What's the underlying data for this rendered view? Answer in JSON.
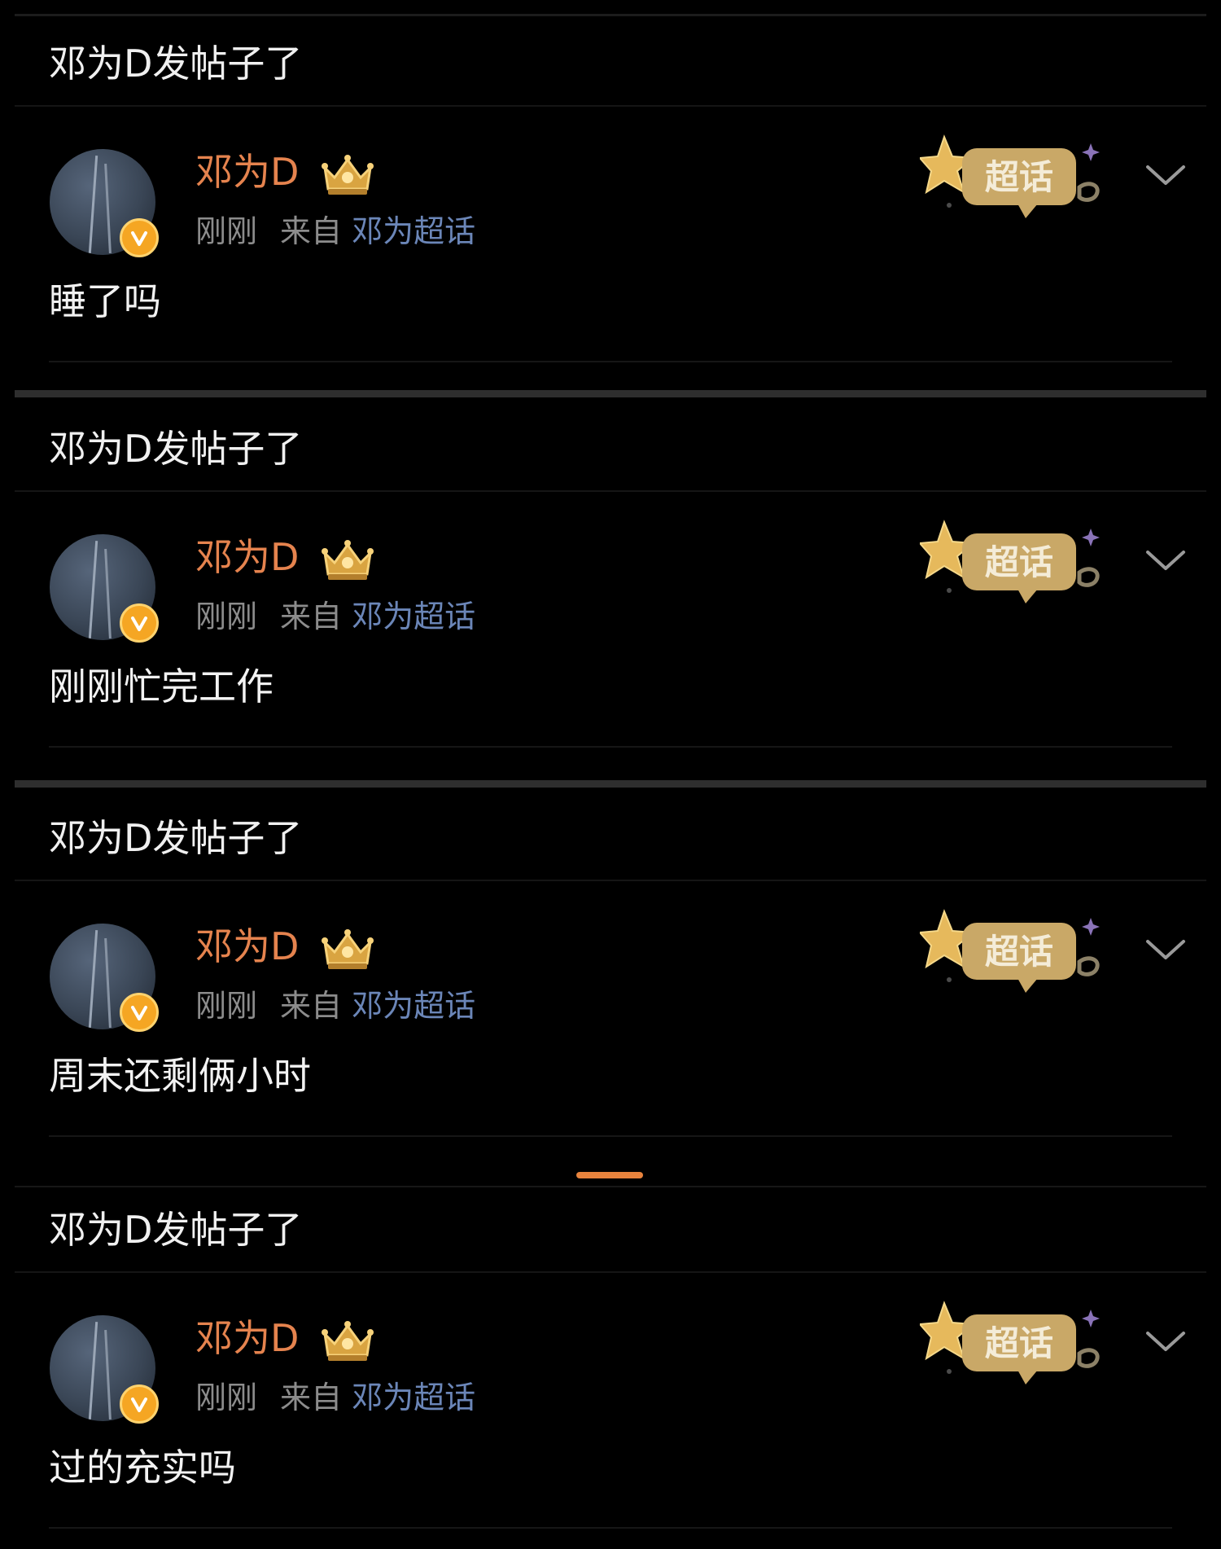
{
  "colors": {
    "background": "#000000",
    "username": "#e5834e",
    "meta_gray": "#8c8c8c",
    "source_link": "#6b86b8",
    "verified_badge": "#f5a623",
    "scroll_indicator": "#e8833d"
  },
  "posts": [
    {
      "header": "邓为D发帖子了",
      "author": {
        "name": "邓为D",
        "avatar_icon": "avatar-image",
        "verified_icon": "verified-v-icon",
        "level_icon": "crown-level-icon"
      },
      "time": "刚刚",
      "source_prefix": "来自",
      "source_name": "邓为超话",
      "sticker": {
        "label": "超话",
        "icon": "chaohua-star-sticker-icon"
      },
      "menu_icon": "chevron-down-icon",
      "text": "睡了吗"
    },
    {
      "header": "邓为D发帖子了",
      "author": {
        "name": "邓为D",
        "avatar_icon": "avatar-image",
        "verified_icon": "verified-v-icon",
        "level_icon": "crown-level-icon"
      },
      "time": "刚刚",
      "source_prefix": "来自",
      "source_name": "邓为超话",
      "sticker": {
        "label": "超话",
        "icon": "chaohua-star-sticker-icon"
      },
      "menu_icon": "chevron-down-icon",
      "text": "刚刚忙完工作"
    },
    {
      "header": "邓为D发帖子了",
      "author": {
        "name": "邓为D",
        "avatar_icon": "avatar-image",
        "verified_icon": "verified-v-icon",
        "level_icon": "crown-level-icon"
      },
      "time": "刚刚",
      "source_prefix": "来自",
      "source_name": "邓为超话",
      "sticker": {
        "label": "超话",
        "icon": "chaohua-star-sticker-icon"
      },
      "menu_icon": "chevron-down-icon",
      "text": "周末还剩俩小时"
    },
    {
      "header": "邓为D发帖子了",
      "author": {
        "name": "邓为D",
        "avatar_icon": "avatar-image",
        "verified_icon": "verified-v-icon",
        "level_icon": "crown-level-icon"
      },
      "time": "刚刚",
      "source_prefix": "来自",
      "source_name": "邓为超话",
      "sticker": {
        "label": "超话",
        "icon": "chaohua-star-sticker-icon"
      },
      "menu_icon": "chevron-down-icon",
      "text": "过的充实吗"
    }
  ]
}
